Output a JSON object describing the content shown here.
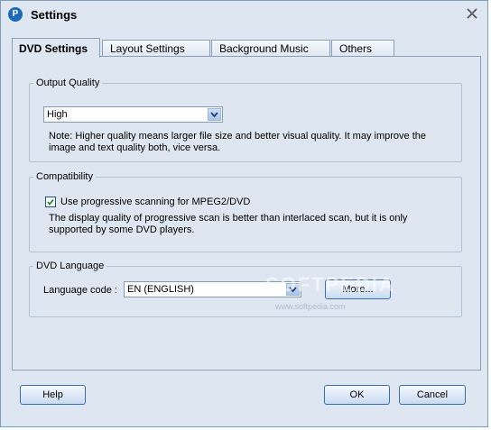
{
  "window": {
    "title": "Settings",
    "app_icon_glyph": "P"
  },
  "tabs": [
    {
      "label": "DVD Settings",
      "active": true
    },
    {
      "label": "Layout Settings",
      "active": false
    },
    {
      "label": "Background Music",
      "active": false
    },
    {
      "label": "Others",
      "active": false
    }
  ],
  "output_quality": {
    "legend": "Output Quality",
    "selected": "High",
    "note_line1": "Note: Higher quality means larger file size and better visual quality. It may improve the",
    "note_line2": "image and text quality both, vice versa."
  },
  "compatibility": {
    "legend": "Compatibility",
    "checkbox_label": "Use progressive scanning for MPEG2/DVD",
    "checked": true,
    "note_line1": "The display quality of progressive scan is better than interlaced scan, but it is only",
    "note_line2": "supported by some DVD players."
  },
  "dvd_language": {
    "legend": "DVD Language",
    "label": "Language code :",
    "selected": "EN (ENGLISH)",
    "more_button": "More..."
  },
  "footer": {
    "help_button": "Help",
    "ok_button": "OK",
    "cancel_button": "Cancel"
  },
  "watermark": {
    "text": "SOFTPEDIA",
    "small_text": "www.softpedia.com"
  },
  "colors": {
    "window_bg": "#dde6f1",
    "border": "#7f9db9",
    "accent": "#1d6bb8"
  },
  "icons": {
    "app": "app-logo-icon",
    "close": "close-icon",
    "dropdown": "chevron-down-icon",
    "check": "checkmark-icon"
  }
}
